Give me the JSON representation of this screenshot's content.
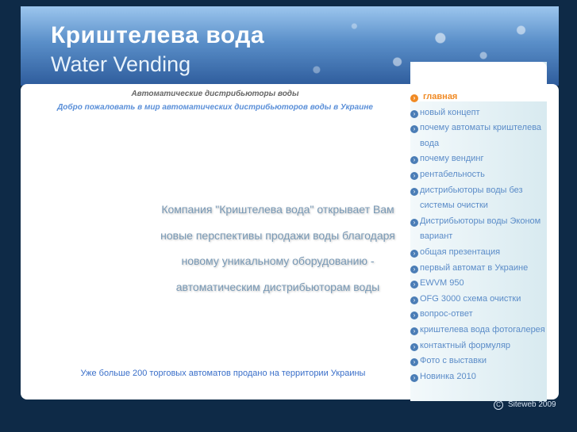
{
  "header": {
    "title": "Криштелева вода",
    "subtitle": "Water Vending"
  },
  "main": {
    "heading": "Автоматические дистрибьюторы воды",
    "welcome": "Добро пожаловать в мир автоматических дистрибьюторов воды в Украине",
    "message_lines": [
      "Компания \"Криштелева вода\" открывает Вам",
      "новые перспективы продажи воды благодаря",
      "новому уникальному оборудованию -",
      "автоматическим дистрибьюторам воды"
    ],
    "footer_note": "Уже больше 200 торговых автоматов продано на территории Украины"
  },
  "sidebar": {
    "items": [
      {
        "label": "главная",
        "active": true,
        "icon": "arrow-bullet-icon"
      },
      {
        "label": "новый концепт",
        "active": false,
        "icon": "arrow-bullet-icon"
      },
      {
        "label": "почему автоматы криштелева вода",
        "active": false,
        "icon": "arrow-bullet-icon"
      },
      {
        "label": "почему вендинг",
        "active": false,
        "icon": "arrow-bullet-icon"
      },
      {
        "label": "рентабельность",
        "active": false,
        "icon": "arrow-bullet-icon"
      },
      {
        "label": "дистрибьюторы воды без системы очистки",
        "active": false,
        "icon": "arrow-bullet-icon"
      },
      {
        "label": "Дистрибьюторы воды Эконом вариант",
        "active": false,
        "icon": "arrow-bullet-icon"
      },
      {
        "label": "общая презентация",
        "active": false,
        "icon": "arrow-bullet-icon"
      },
      {
        "label": "первый автомат в Украине",
        "active": false,
        "icon": "arrow-bullet-icon"
      },
      {
        "label": "EWVM 950",
        "active": false,
        "icon": "arrow-bullet-icon"
      },
      {
        "label": "OFG 3000 схема очистки",
        "active": false,
        "icon": "arrow-bullet-icon"
      },
      {
        "label": "вопрос-ответ",
        "active": false,
        "icon": "arrow-bullet-icon"
      },
      {
        "label": "криштелева вода фотогалерея",
        "active": false,
        "icon": "arrow-bullet-icon"
      },
      {
        "label": "контактный формуляр",
        "active": false,
        "icon": "arrow-bullet-icon"
      },
      {
        "label": "Фото с выставки",
        "active": false,
        "icon": "arrow-bullet-icon"
      },
      {
        "label": "Новинка 2010",
        "active": false,
        "icon": "arrow-bullet-icon"
      }
    ]
  },
  "footer": {
    "copyright": "Siteweb 2009"
  },
  "colors": {
    "background": "#0e2a47",
    "accent": "#f08a24",
    "link": "#5b8cc8"
  }
}
